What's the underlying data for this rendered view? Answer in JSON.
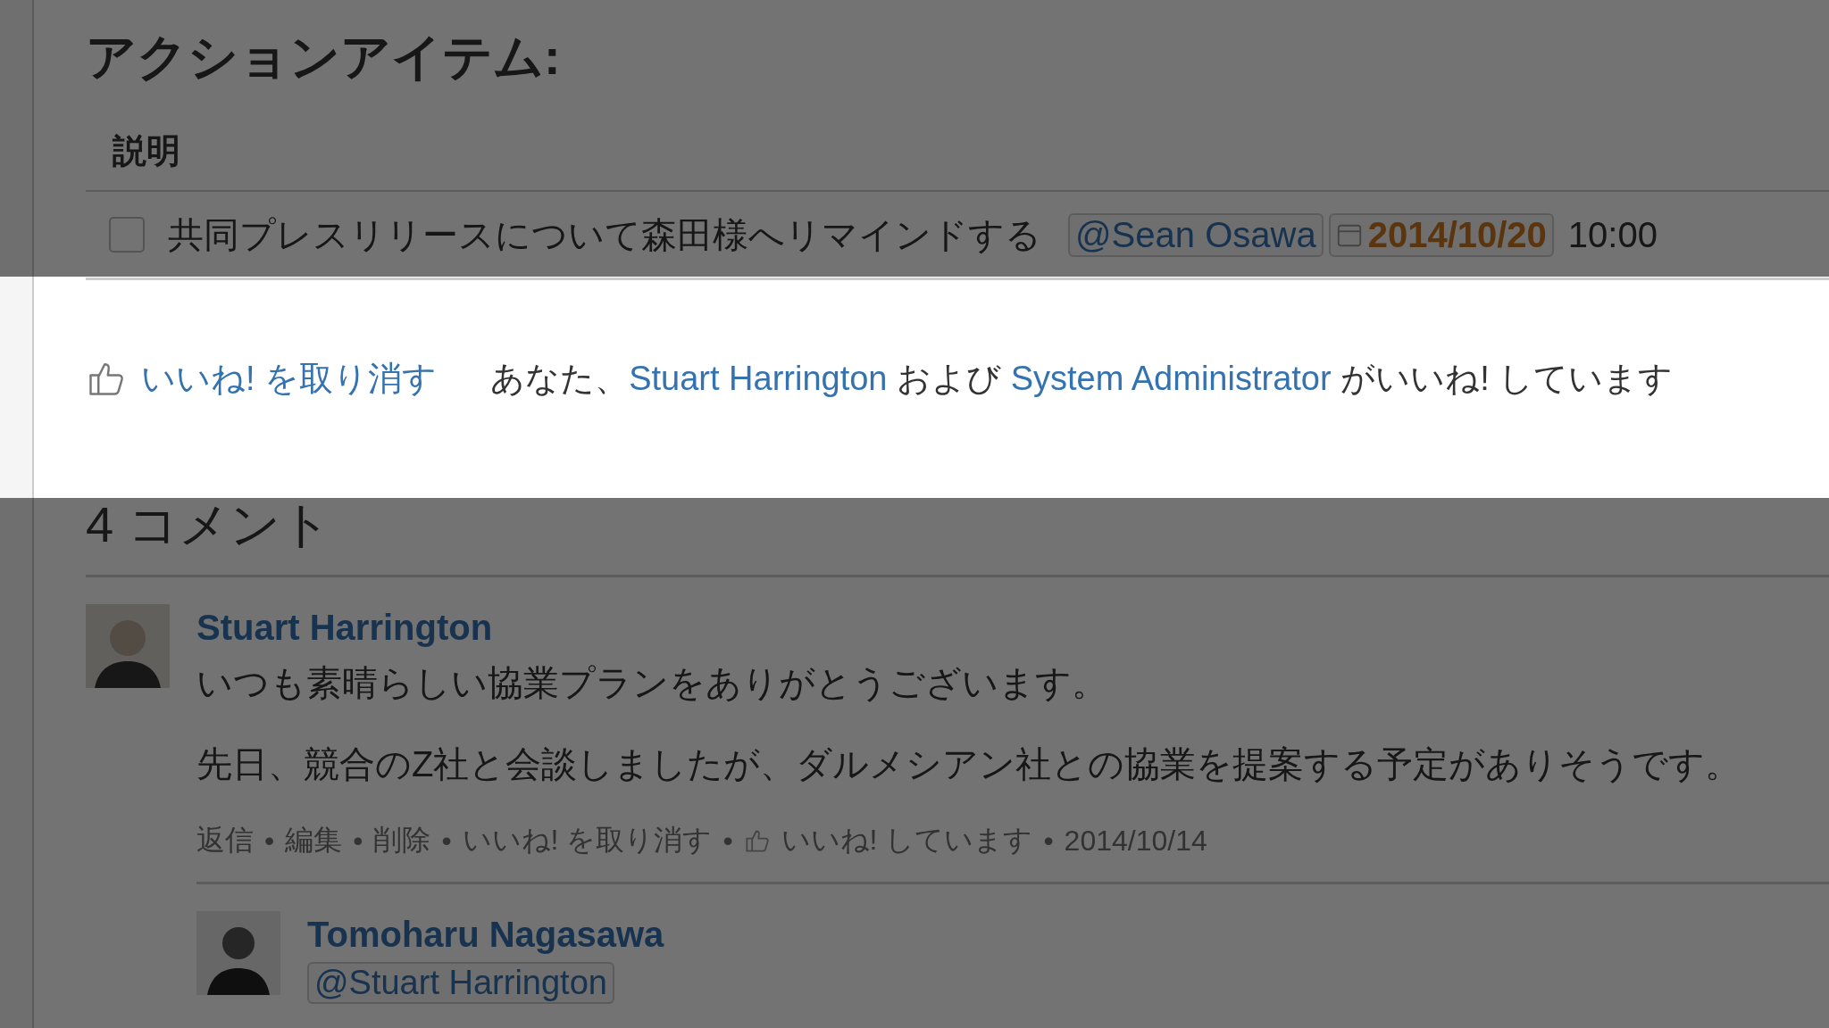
{
  "action_items": {
    "heading": "アクションアイテム:",
    "column": "説明",
    "tasks": [
      {
        "text": "共同プレスリリースについて森田様へリマインドする",
        "checked": false,
        "mention": "@Sean Osawa",
        "due_date": "2014/10/20",
        "time": "10:00"
      }
    ]
  },
  "likes": {
    "unlike_link": "いいね! を取り消す",
    "summary": [
      {
        "kind": "text",
        "text": "あなた、"
      },
      {
        "kind": "link",
        "text": "Stuart Harrington"
      },
      {
        "kind": "text",
        "text": " および "
      },
      {
        "kind": "link",
        "text": "System Administrator"
      },
      {
        "kind": "text",
        "text": " がいいね! しています"
      }
    ]
  },
  "comments": {
    "heading": "4 コメント",
    "items": [
      {
        "author": "Stuart Harrington",
        "paragraphs": [
          "いつも素晴らしい協業プランをありがとうございます。",
          "先日、競合のZ社と会談しましたが、ダルメシアン社との協業を提案する予定がありそうです。"
        ],
        "separator": "•",
        "actions": [
          {
            "kind": "link",
            "text": "返信"
          },
          {
            "kind": "link",
            "text": "編集"
          },
          {
            "kind": "link",
            "text": "削除"
          },
          {
            "kind": "link",
            "text": "いいね! を取り消す"
          },
          {
            "kind": "likes",
            "text": "いいね! しています"
          },
          {
            "kind": "date",
            "text": "2014/10/14"
          }
        ],
        "replies": [
          {
            "author": "Tomoharu Nagasawa",
            "mention": "@Stuart Harrington"
          }
        ]
      }
    ]
  }
}
